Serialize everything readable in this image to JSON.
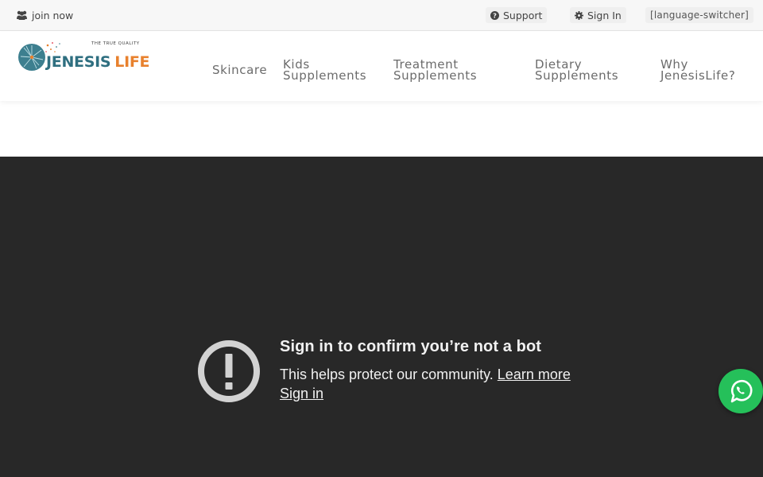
{
  "topbar": {
    "join_label": "join now",
    "support_label": "Support",
    "signin_label": "Sign In",
    "language_switcher": "[language-switcher]"
  },
  "header": {
    "logo": {
      "tagline": "THE TRUE QUALITY",
      "word_primary": "JENESIS",
      "word_secondary": "LIFE",
      "primary_color": "#2f6f80",
      "accent_color": "#e8812e"
    },
    "nav": [
      {
        "line1": "Skincare",
        "line2": ""
      },
      {
        "line1": "Kids",
        "line2": "Supplements"
      },
      {
        "line1": "Treatment",
        "line2": "Supplements"
      },
      {
        "line1": "Dietary",
        "line2": "Supplements"
      },
      {
        "line1": "Why",
        "line2": "JenesisLife?"
      }
    ]
  },
  "video": {
    "title": "Sign in to confirm you’re not a bot",
    "description": "This helps protect our community.",
    "learn_more": "Learn more",
    "signin_link": "Sign in",
    "background": "#282828"
  },
  "whatsapp": {
    "icon": "whatsapp-icon",
    "color": "#25c05a"
  }
}
